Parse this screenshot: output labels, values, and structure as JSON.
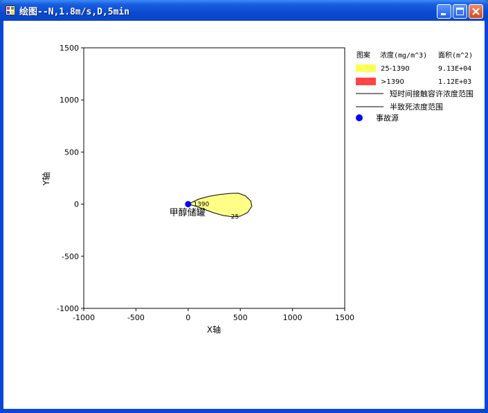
{
  "window": {
    "title": "绘图--N,1.8m/s,D,5min"
  },
  "icons": {
    "app": "app-window-icon",
    "minimize": "minimize-icon",
    "maximize": "maximize-icon",
    "close": "close-icon",
    "source": "filled-circle-icon"
  },
  "plot": {
    "xlabel": "X轴",
    "ylabel": "Y轴",
    "xlim": [
      -1000,
      1500
    ],
    "ylim": [
      -1000,
      1500
    ],
    "xticks": [
      "-1000",
      "-500",
      "0",
      "500",
      "1000",
      "1500"
    ],
    "yticks": [
      "1500",
      "1000",
      "500",
      "0",
      "-500",
      "-1000"
    ],
    "source_label": "甲醇储罐",
    "contour_label_inner": "1390",
    "contour_label_outer": "25",
    "plume_color": "#ffff88",
    "source_color": "#0000ff"
  },
  "legend": {
    "header_symbol": "图案",
    "header_conc": "浓度(mg/m^3)",
    "header_area": "面积(m^2)",
    "rows": [
      {
        "color": "#ffff55",
        "label": "25-1390",
        "area": "9.13E+04"
      },
      {
        "color": "#ff4444",
        "label": ">1390",
        "area": "1.12E+03"
      }
    ],
    "line1_label": "短时间接触容许浓度范围",
    "line2_label": "半致死浓度范围",
    "source_label": "事故源"
  }
}
